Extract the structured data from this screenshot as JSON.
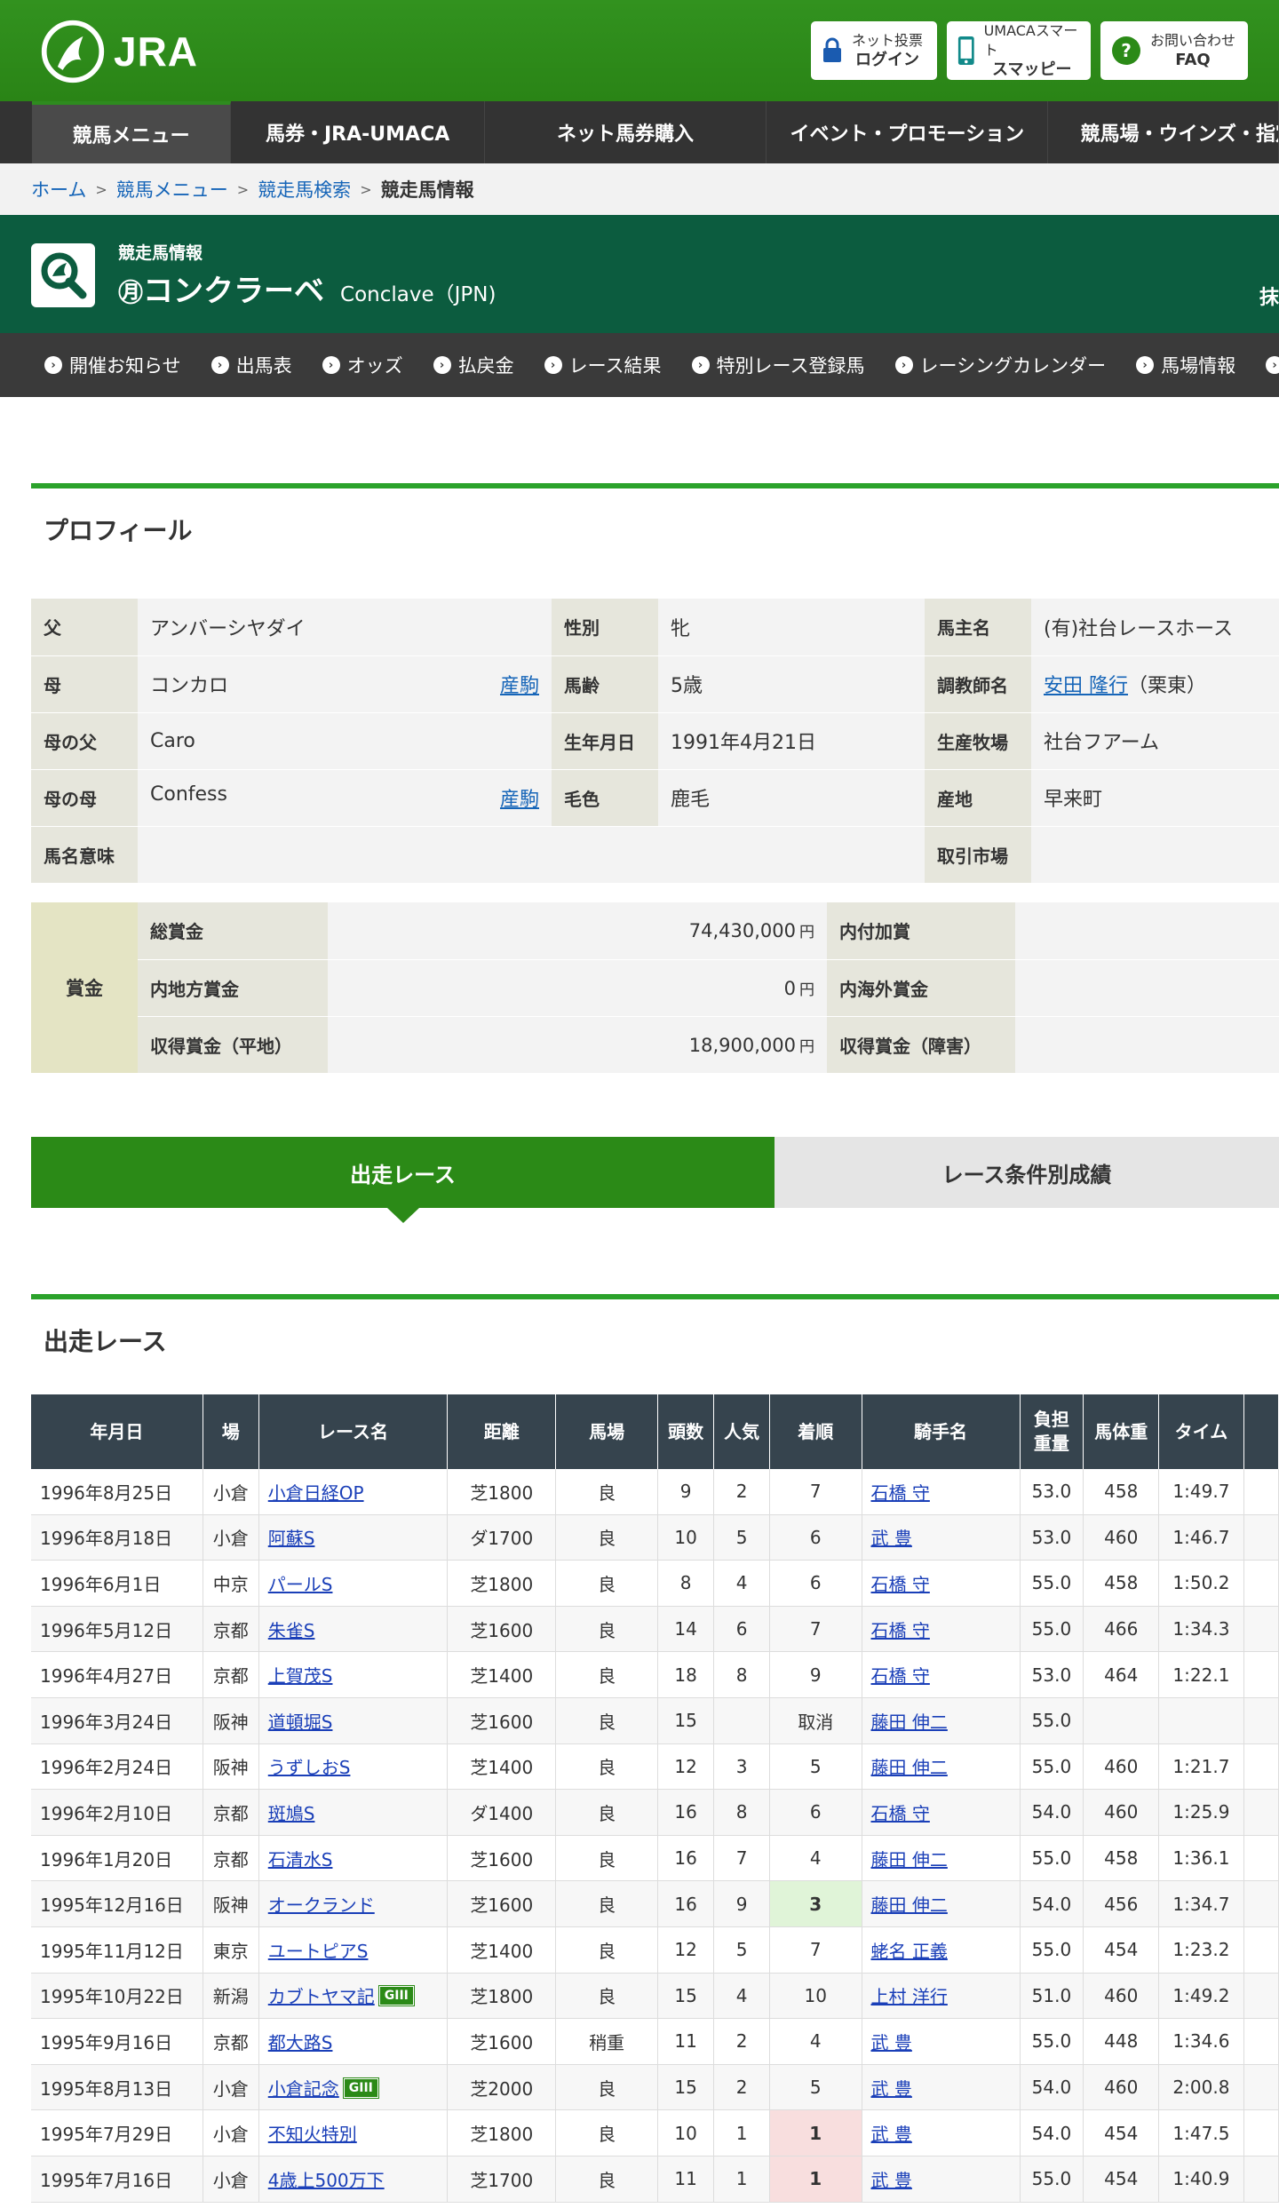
{
  "header": {
    "logo_text": "JRA",
    "login_line1": "ネット投票",
    "login_line2": "ログイン",
    "umaca_line1": "UMACAスマート",
    "umaca_line2": "スマッピー",
    "faq_line1": "お問い合わせ",
    "faq_line2": "FAQ"
  },
  "gnav": [
    "競馬メニュー",
    "馬券・JRA-UMACA",
    "ネット馬券購入",
    "イベント・プロモーション",
    "競馬場・ウインズ・指定"
  ],
  "breadcrumb": [
    "ホーム",
    "競馬メニュー",
    "競走馬検索",
    "競走馬情報"
  ],
  "title": {
    "small": "競走馬情報",
    "mark": "㊊",
    "name": "コンクラーベ",
    "en": "Conclave（JPN)",
    "right_fragment": "抹"
  },
  "subnav": [
    "開催お知らせ",
    "出馬表",
    "オッズ",
    "払戻金",
    "レース結果",
    "特別レース登録馬",
    "レーシングカレンダー",
    "馬場情報"
  ],
  "profile": {
    "heading": "プロフィール",
    "sire_k": "父",
    "sire_v": "アンバーシヤダイ",
    "sex_k": "性別",
    "sex_v": "牝",
    "owner_k": "馬主名",
    "owner_v": "(有)社台レースホース",
    "dam_k": "母",
    "dam_v": "コンカロ",
    "dam_link": "産駒",
    "age_k": "馬齢",
    "age_v": "5歳",
    "trainer_k": "調教師名",
    "trainer_v": "安田 隆行",
    "trainer_loc": "（栗東）",
    "damsire_k": "母の父",
    "damsire_v": "Caro",
    "birth_k": "生年月日",
    "birth_v": "1991年4月21日",
    "breeder_k": "生産牧場",
    "breeder_v": "社台フアーム",
    "granddam_k": "母の母",
    "granddam_v": "Confess",
    "granddam_link": "産駒",
    "color_k": "毛色",
    "color_v": "鹿毛",
    "origin_k": "産地",
    "origin_v": "早来町",
    "meaning_k": "馬名意味",
    "market_k": "取引市場"
  },
  "prize": {
    "label": "賞金",
    "total_k": "総賞金",
    "total_v": "74,430,000",
    "addon_k": "内付加賞",
    "local_k": "内地方賞金",
    "local_v": "0",
    "overseas_k": "内海外賞金",
    "flat_k": "収得賞金（平地）",
    "flat_v": "18,900,000",
    "jump_k": "収得賞金（障害）",
    "yen": "円"
  },
  "tabs": {
    "active": "出走レース",
    "inactive": "レース条件別成績"
  },
  "races_heading": "出走レース",
  "columns": [
    "年月日",
    "場",
    "レース名",
    "距離",
    "馬場",
    "頭数",
    "人気",
    "着順",
    "騎手名",
    "負担重量",
    "馬体重",
    "タイム"
  ],
  "races": [
    {
      "date": "1996年8月25日",
      "course": "小倉",
      "race": "小倉日経OP",
      "grade": "",
      "dist": "芝1800",
      "cond": "良",
      "runners": "9",
      "pop": "2",
      "pos": "7",
      "jockey": "石橋 守",
      "wt": "53.0",
      "bw": "458",
      "time": "1:49.7"
    },
    {
      "date": "1996年8月18日",
      "course": "小倉",
      "race": "阿蘇S",
      "grade": "",
      "dist": "ダ1700",
      "cond": "良",
      "runners": "10",
      "pop": "5",
      "pos": "6",
      "jockey": "武 豊",
      "wt": "53.0",
      "bw": "460",
      "time": "1:46.7"
    },
    {
      "date": "1996年6月1日",
      "course": "中京",
      "race": "パールS",
      "grade": "",
      "dist": "芝1800",
      "cond": "良",
      "runners": "8",
      "pop": "4",
      "pos": "6",
      "jockey": "石橋 守",
      "wt": "55.0",
      "bw": "458",
      "time": "1:50.2"
    },
    {
      "date": "1996年5月12日",
      "course": "京都",
      "race": "朱雀S",
      "grade": "",
      "dist": "芝1600",
      "cond": "良",
      "runners": "14",
      "pop": "6",
      "pos": "7",
      "jockey": "石橋 守",
      "wt": "55.0",
      "bw": "466",
      "time": "1:34.3"
    },
    {
      "date": "1996年4月27日",
      "course": "京都",
      "race": "上賀茂S",
      "grade": "",
      "dist": "芝1400",
      "cond": "良",
      "runners": "18",
      "pop": "8",
      "pos": "9",
      "jockey": "石橋 守",
      "wt": "53.0",
      "bw": "464",
      "time": "1:22.1"
    },
    {
      "date": "1996年3月24日",
      "course": "阪神",
      "race": "道頓堀S",
      "grade": "",
      "dist": "芝1600",
      "cond": "良",
      "runners": "15",
      "pop": "",
      "pos": "取消",
      "jockey": "藤田 伸二",
      "wt": "55.0",
      "bw": "",
      "time": ""
    },
    {
      "date": "1996年2月24日",
      "course": "阪神",
      "race": "うずしおS",
      "grade": "",
      "dist": "芝1400",
      "cond": "良",
      "runners": "12",
      "pop": "3",
      "pos": "5",
      "jockey": "藤田 伸二",
      "wt": "55.0",
      "bw": "460",
      "time": "1:21.7"
    },
    {
      "date": "1996年2月10日",
      "course": "京都",
      "race": "斑鳩S",
      "grade": "",
      "dist": "ダ1400",
      "cond": "良",
      "runners": "16",
      "pop": "8",
      "pos": "6",
      "jockey": "石橋 守",
      "wt": "54.0",
      "bw": "460",
      "time": "1:25.9"
    },
    {
      "date": "1996年1月20日",
      "course": "京都",
      "race": "石清水S",
      "grade": "",
      "dist": "芝1600",
      "cond": "良",
      "runners": "16",
      "pop": "7",
      "pos": "4",
      "jockey": "藤田 伸二",
      "wt": "55.0",
      "bw": "458",
      "time": "1:36.1"
    },
    {
      "date": "1995年12月16日",
      "course": "阪神",
      "race": "オークランド",
      "grade": "",
      "dist": "芝1600",
      "cond": "良",
      "runners": "16",
      "pop": "9",
      "pos": "3",
      "jockey": "藤田 伸二",
      "wt": "54.0",
      "bw": "456",
      "time": "1:34.7"
    },
    {
      "date": "1995年11月12日",
      "course": "東京",
      "race": "ユートピアS",
      "grade": "",
      "dist": "芝1400",
      "cond": "良",
      "runners": "12",
      "pop": "5",
      "pos": "7",
      "jockey": "蛯名 正義",
      "wt": "55.0",
      "bw": "454",
      "time": "1:23.2"
    },
    {
      "date": "1995年10月22日",
      "course": "新潟",
      "race": "カブトヤマ記",
      "grade": "GIII",
      "dist": "芝1800",
      "cond": "良",
      "runners": "15",
      "pop": "4",
      "pos": "10",
      "jockey": "上村 洋行",
      "wt": "51.0",
      "bw": "460",
      "time": "1:49.2"
    },
    {
      "date": "1995年9月16日",
      "course": "京都",
      "race": "都大路S",
      "grade": "",
      "dist": "芝1600",
      "cond": "稍重",
      "runners": "11",
      "pop": "2",
      "pos": "4",
      "jockey": "武 豊",
      "wt": "55.0",
      "bw": "448",
      "time": "1:34.6"
    },
    {
      "date": "1995年8月13日",
      "course": "小倉",
      "race": "小倉記念",
      "grade": "GIII",
      "dist": "芝2000",
      "cond": "良",
      "runners": "15",
      "pop": "2",
      "pos": "5",
      "jockey": "武 豊",
      "wt": "54.0",
      "bw": "460",
      "time": "2:00.8"
    },
    {
      "date": "1995年7月29日",
      "course": "小倉",
      "race": "不知火特別",
      "grade": "",
      "dist": "芝1800",
      "cond": "良",
      "runners": "10",
      "pop": "1",
      "pos": "1",
      "jockey": "武 豊",
      "wt": "54.0",
      "bw": "454",
      "time": "1:47.5"
    },
    {
      "date": "1995年7月16日",
      "course": "小倉",
      "race": "4歳上500万下",
      "grade": "",
      "dist": "芝1700",
      "cond": "良",
      "runners": "11",
      "pop": "1",
      "pos": "1",
      "jockey": "武 豊",
      "wt": "55.0",
      "bw": "454",
      "time": "1:40.9"
    }
  ]
}
